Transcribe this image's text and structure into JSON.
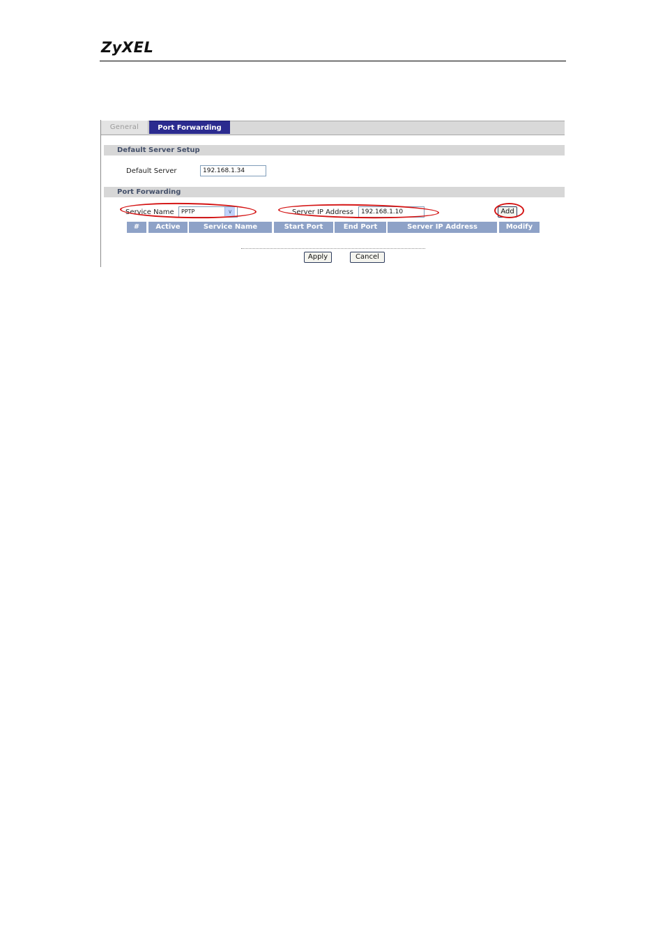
{
  "document": {
    "logo_text": "ZyXEL"
  },
  "tabs": [
    {
      "label": "General",
      "active": false
    },
    {
      "label": "Port Forwarding",
      "active": true
    }
  ],
  "default_server_setup": {
    "section_title": "Default Server Setup",
    "label": "Default Server",
    "value": "192.168.1.34"
  },
  "port_forwarding": {
    "section_title": "Port Forwarding",
    "service_name_label": "Service Name",
    "service_name_value": "PPTP",
    "server_ip_label": "Server IP Address",
    "server_ip_value": "192.168.1.10",
    "add_label": "Add",
    "table_columns": [
      "#",
      "Active",
      "Service Name",
      "Start Port",
      "End Port",
      "Server IP Address",
      "Modify"
    ],
    "table_rows": []
  },
  "actions": {
    "apply_label": "Apply",
    "cancel_label": "Cancel"
  },
  "colors": {
    "active_tab": "#2b2b8f",
    "section_bar": "#d7d7d7",
    "table_header": "#8ea2c7",
    "annotation": "#d41414"
  }
}
